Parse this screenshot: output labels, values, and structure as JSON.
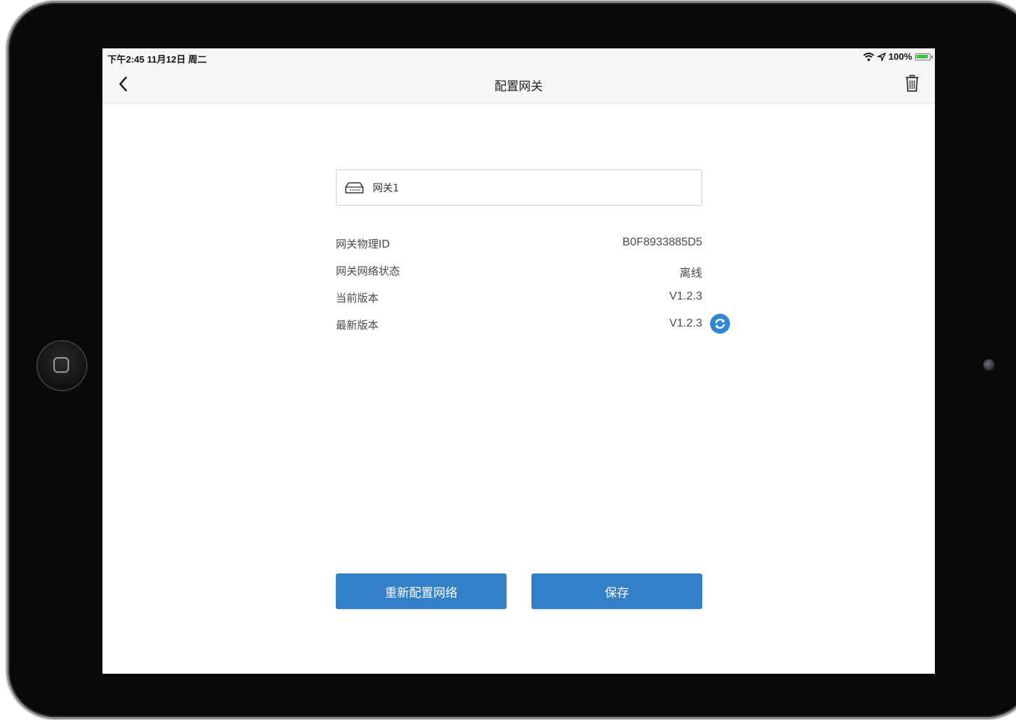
{
  "status_bar": {
    "time_date": "下午2:45  11月12日 周二",
    "battery_percent": "100%",
    "battery_level": 1.0
  },
  "nav": {
    "title": "配置网关",
    "back_icon": "chevron-left-icon",
    "delete_icon": "trash-icon"
  },
  "gateway_name": {
    "value": "网关1",
    "icon": "gateway-icon"
  },
  "info": {
    "physical_id_label": "网关物理ID",
    "physical_id_value": "B0F8933885D5",
    "network_status_label": "网关网络状态",
    "network_status_value": "离线",
    "current_version_label": "当前版本",
    "current_version_value": "V1.2.3",
    "latest_version_label": "最新版本",
    "latest_version_value": "V1.2.3",
    "refresh_icon": "refresh-icon"
  },
  "buttons": {
    "reconfigure_label": "重新配置网络",
    "save_label": "保存"
  },
  "colors": {
    "primary": "#3380c8",
    "refresh": "#2f86d4",
    "battery": "#3cc63c"
  }
}
